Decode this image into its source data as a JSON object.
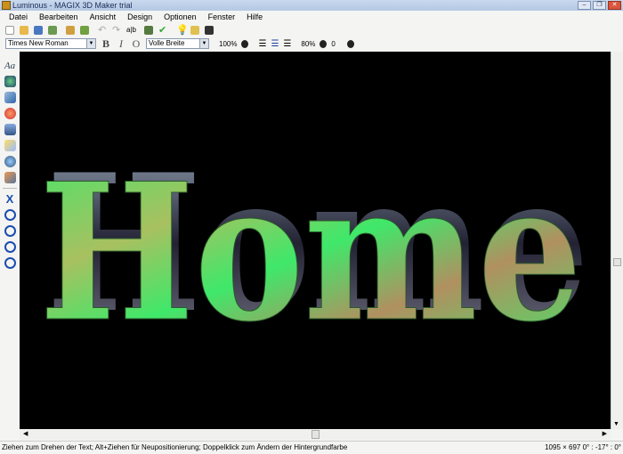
{
  "window": {
    "title": "Luminous - MAGIX 3D Maker trial"
  },
  "menu": [
    "Datei",
    "Bearbeiten",
    "Ansicht",
    "Design",
    "Optionen",
    "Fenster",
    "Hilfe"
  ],
  "format": {
    "font": "Times New Roman",
    "bold": "B",
    "italic": "I",
    "outline": "O",
    "width_mode": "Volle Breite",
    "scale": "100%",
    "spacing": "80%",
    "offset": "0"
  },
  "canvas": {
    "text": "Home",
    "background": "#000000",
    "text_color": "#3fe86a"
  },
  "status": {
    "hint": "Ziehen zum Drehen der Text; Alt+Ziehen für Neupositionierung; Doppelklick zum Ändern der Hintergrundfarbe",
    "info": "1095 × 697  0° : -17° : 0°"
  },
  "left_tools": {
    "text_tool": "Aa"
  }
}
